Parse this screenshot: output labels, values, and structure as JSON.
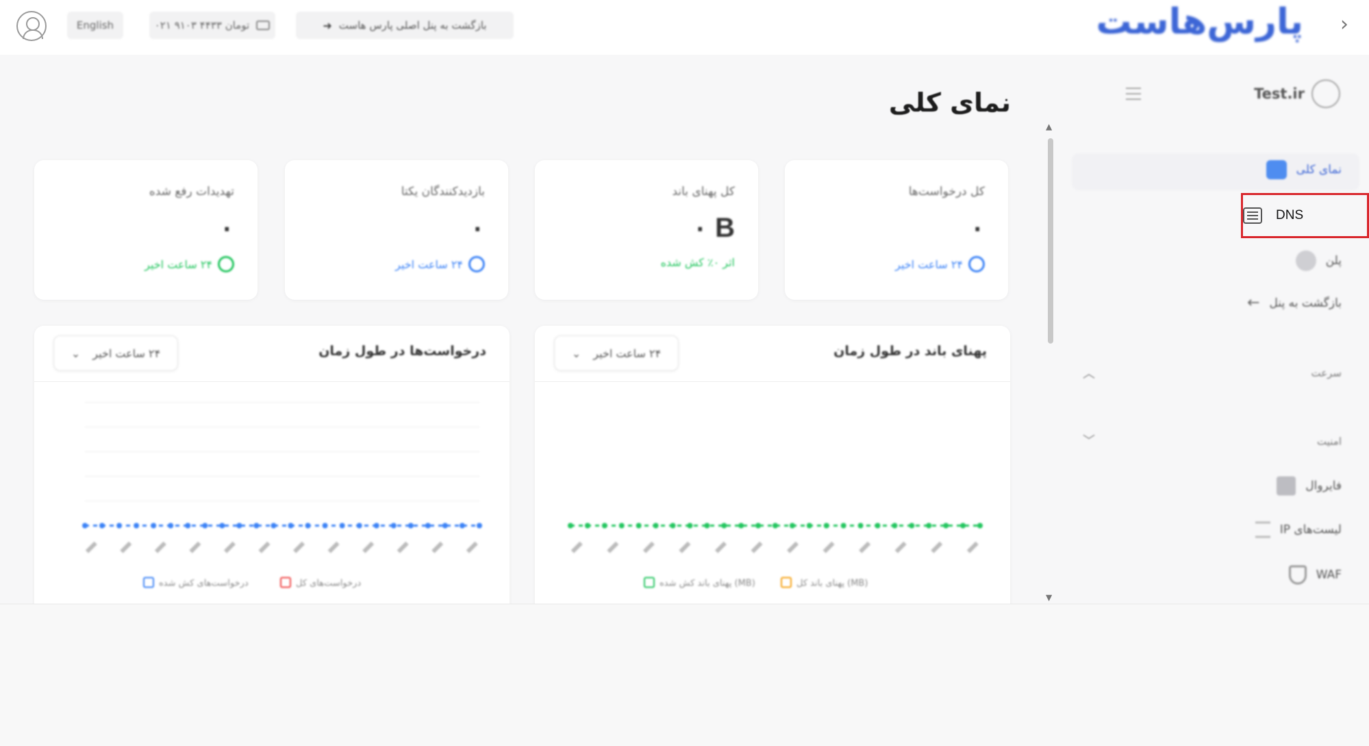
{
  "topbar": {
    "lang_label": "English",
    "phone_label": "۰۲۱ ۹۱۰۳ ۴۴۳۳ تومان",
    "back_label": "بازگشت به پنل اصلی پارس هاست",
    "logo_text": "پارس‌هاست"
  },
  "sidebar": {
    "username": "Test.ir",
    "items": [
      {
        "label": "نمای کلی",
        "icon": "house-icon",
        "active": true
      },
      {
        "label": "DNS",
        "icon": "list-icon",
        "highlighted": true
      },
      {
        "label": "پلن",
        "icon": "plan-icon"
      },
      {
        "label": "بازگشت به پنل",
        "icon": "back-arrow-icon"
      }
    ],
    "sections": [
      {
        "label": "سرعت",
        "chevron": "chevron-up-icon"
      },
      {
        "label": "امنیت",
        "chevron": "chevron-down-icon"
      }
    ],
    "security_items": [
      {
        "label": "فایروال",
        "icon": "firewall-icon"
      },
      {
        "label": "لیست‌های IP",
        "icon": "ip-list-icon"
      },
      {
        "label": "WAF",
        "icon": "shield-icon"
      }
    ]
  },
  "main": {
    "title": "نمای کلی",
    "stats": [
      {
        "title": "کل درخواست‌ها",
        "value": "۰",
        "foot": "۲۴ ساعت اخیر",
        "foot_color": "#3b82f6",
        "icon": "clock-icon"
      },
      {
        "title": "کل پهنای باند",
        "value": "۰ B",
        "foot": "اثر ۰٪ کش شده",
        "foot_color": "#22c55e",
        "icon": "percent-icon"
      },
      {
        "title": "بازدیدکنندگان یکتا",
        "value": "۰",
        "foot": "۲۴ ساعت اخیر",
        "foot_color": "#3b82f6",
        "icon": "users-icon"
      },
      {
        "title": "تهدیدات رفع شده",
        "value": "۰",
        "foot": "۲۴ ساعت اخیر",
        "foot_color": "#22c55e",
        "icon": "shield-icon"
      }
    ],
    "charts": [
      {
        "title": "پهنای باند در طول زمان",
        "select_value": "۲۴ ساعت اخیر",
        "point_color": "#22c55e",
        "legend": [
          "پهنای باند کش شده (MB)",
          "پهنای باند کل (MB)"
        ]
      },
      {
        "title": "درخواست‌ها در طول زمان",
        "select_value": "۲۴ ساعت اخیر",
        "point_color": "#3b82f6",
        "legend": [
          "درخواست‌های کش شده",
          "درخواست‌های کل"
        ]
      }
    ]
  },
  "colors": {
    "accent": "#3d66d6",
    "highlight_border": "#d9262c",
    "green": "#22c55e",
    "blue": "#3b82f6"
  }
}
